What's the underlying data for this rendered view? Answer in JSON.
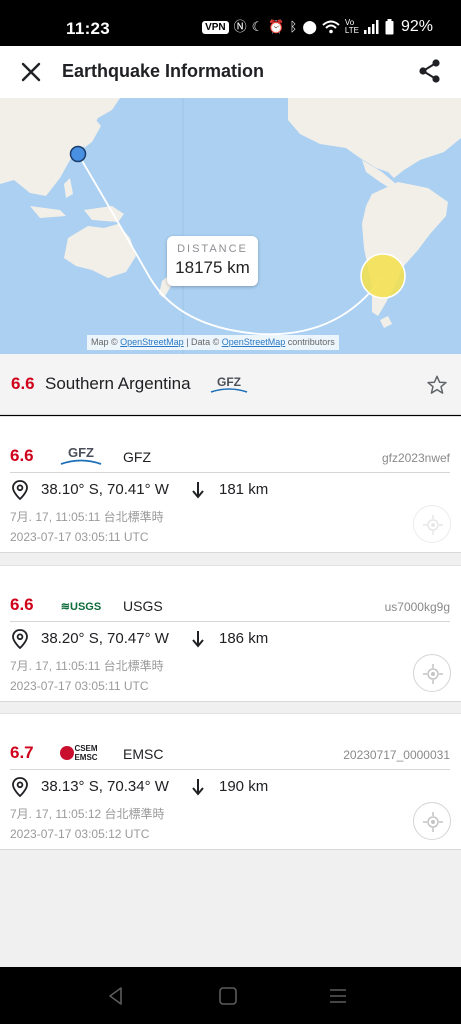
{
  "status_bar": {
    "time": "11:23",
    "vpn": "VPN",
    "battery": "92%",
    "icons": [
      "nfc-icon",
      "moon-icon",
      "alarm-icon",
      "bluetooth-icon",
      "location-icon",
      "wifi-icon",
      "volte-icon",
      "signal-icon",
      "battery-icon"
    ]
  },
  "header": {
    "title": "Earthquake Information",
    "close_icon": "close-icon",
    "share_icon": "share-icon"
  },
  "map": {
    "distance_label": "DISTANCE",
    "distance_value": "18175 km",
    "attribution_prefix": "Map ©",
    "attribution_link1": "OpenStreetMap",
    "attribution_mid": "| Data ©",
    "attribution_link2": "OpenStreetMap",
    "attribution_suffix": "contributors",
    "colors": {
      "water": "#abd0f1",
      "land": "#f2efe9",
      "user_marker": "#4a90e2",
      "quake_marker": "#f5e14a"
    }
  },
  "summary": {
    "magnitude": "6.6",
    "region": "Southern Argentina",
    "agency_logo": "GFZ",
    "favorite_icon": "star-outline-icon"
  },
  "reports": [
    {
      "magnitude": "6.6",
      "agency": "GFZ",
      "logo_text": "GFZ",
      "event_id": "gfz2023nwef",
      "coords": "38.10° S, 70.41° W",
      "depth": "181 km",
      "local_time": "7月. 17, 11:05:11 台北標準時",
      "utc_time": "2023-07-17 03:05:11 UTC"
    },
    {
      "magnitude": "6.6",
      "agency": "USGS",
      "logo_text": "≋USGS",
      "event_id": "us7000kg9g",
      "coords": "38.20° S, 70.47° W",
      "depth": "186 km",
      "local_time": "7月. 17, 11:05:11 台北標準時",
      "utc_time": "2023-07-17 03:05:11 UTC"
    },
    {
      "magnitude": "6.7",
      "agency": "EMSC",
      "logo_text_top": "CSEM",
      "logo_text_bottom": "EMSC",
      "event_id": "20230717_0000031",
      "coords": "38.13° S, 70.34° W",
      "depth": "190 km",
      "local_time": "7月. 17, 11:05:12 台北標準時",
      "utc_time": "2023-07-17 03:05:12 UTC"
    }
  ],
  "colors": {
    "magnitude": "#d0021b",
    "accent": "#202124"
  }
}
